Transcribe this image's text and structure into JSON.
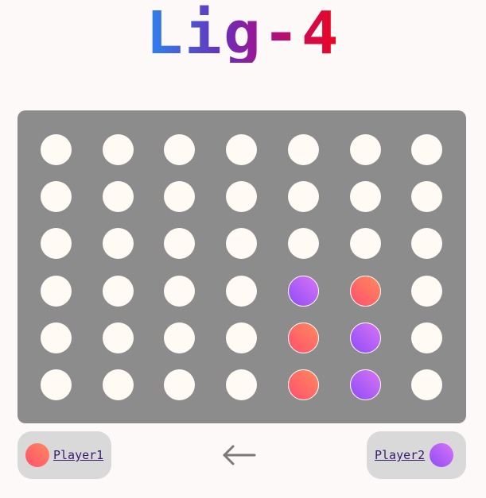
{
  "title": "Lig-4",
  "board": {
    "columns": 7,
    "rows": 6,
    "cells": [
      [
        "empty",
        "empty",
        "empty",
        "empty",
        "empty",
        "empty",
        "empty"
      ],
      [
        "empty",
        "empty",
        "empty",
        "empty",
        "empty",
        "empty",
        "empty"
      ],
      [
        "empty",
        "empty",
        "empty",
        "empty",
        "empty",
        "empty",
        "empty"
      ],
      [
        "empty",
        "empty",
        "empty",
        "empty",
        "player2",
        "player1",
        "empty"
      ],
      [
        "empty",
        "empty",
        "empty",
        "empty",
        "player1",
        "player2",
        "empty"
      ],
      [
        "empty",
        "empty",
        "empty",
        "empty",
        "player1",
        "player2",
        "empty"
      ]
    ]
  },
  "players": {
    "player1": {
      "name": "Player1",
      "color_start": "#ff4f6e",
      "color_end": "#ff8a5c"
    },
    "player2": {
      "name": "Player2",
      "color_start": "#8f4cf7",
      "color_end": "#d874f4"
    }
  },
  "turn_indicator": {
    "icon": "arrow-left-icon",
    "points_to": "player1"
  },
  "colors": {
    "background": "#fdf9f8",
    "board": "#8c8c8c",
    "empty_slot": "#fffaf3",
    "player_card": "#d9d9d9"
  }
}
